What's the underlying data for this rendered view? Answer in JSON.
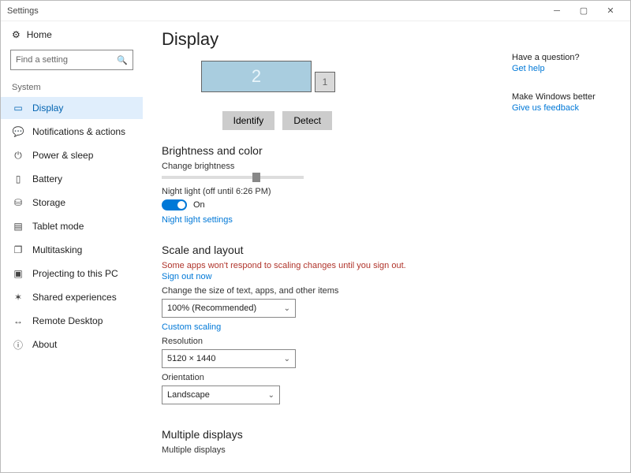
{
  "window": {
    "title": "Settings"
  },
  "sidebar": {
    "home": "Home",
    "search_placeholder": "Find a setting",
    "group": "System",
    "items": [
      {
        "label": "Display",
        "icon": "▭"
      },
      {
        "label": "Notifications & actions",
        "icon": "💬"
      },
      {
        "label": "Power & sleep",
        "icon": "⏻"
      },
      {
        "label": "Battery",
        "icon": "▯"
      },
      {
        "label": "Storage",
        "icon": "⛁"
      },
      {
        "label": "Tablet mode",
        "icon": "▤"
      },
      {
        "label": "Multitasking",
        "icon": "❐"
      },
      {
        "label": "Projecting to this PC",
        "icon": "▣"
      },
      {
        "label": "Shared experiences",
        "icon": "✶"
      },
      {
        "label": "Remote Desktop",
        "icon": "↔"
      },
      {
        "label": "About",
        "icon": "ⓘ"
      }
    ]
  },
  "main": {
    "title": "Display",
    "monitor_2": "2",
    "monitor_1": "1",
    "identify": "Identify",
    "detect": "Detect",
    "brightness_section": "Brightness and color",
    "change_brightness": "Change brightness",
    "night_light_label": "Night light (off until 6:26 PM)",
    "night_light_state": "On",
    "night_light_settings": "Night light settings",
    "scale_section": "Scale and layout",
    "scale_warning": "Some apps won't respond to scaling changes until you sign out.",
    "sign_out_now": "Sign out now",
    "scale_label": "Change the size of text, apps, and other items",
    "scale_value": "100% (Recommended)",
    "custom_scaling": "Custom scaling",
    "resolution_label": "Resolution",
    "resolution_value": "5120 × 1440",
    "orientation_label": "Orientation",
    "orientation_value": "Landscape",
    "multiple_displays_section": "Multiple displays",
    "multiple_displays_label": "Multiple displays"
  },
  "right": {
    "question": "Have a question?",
    "get_help": "Get help",
    "make_better": "Make Windows better",
    "feedback": "Give us feedback"
  }
}
